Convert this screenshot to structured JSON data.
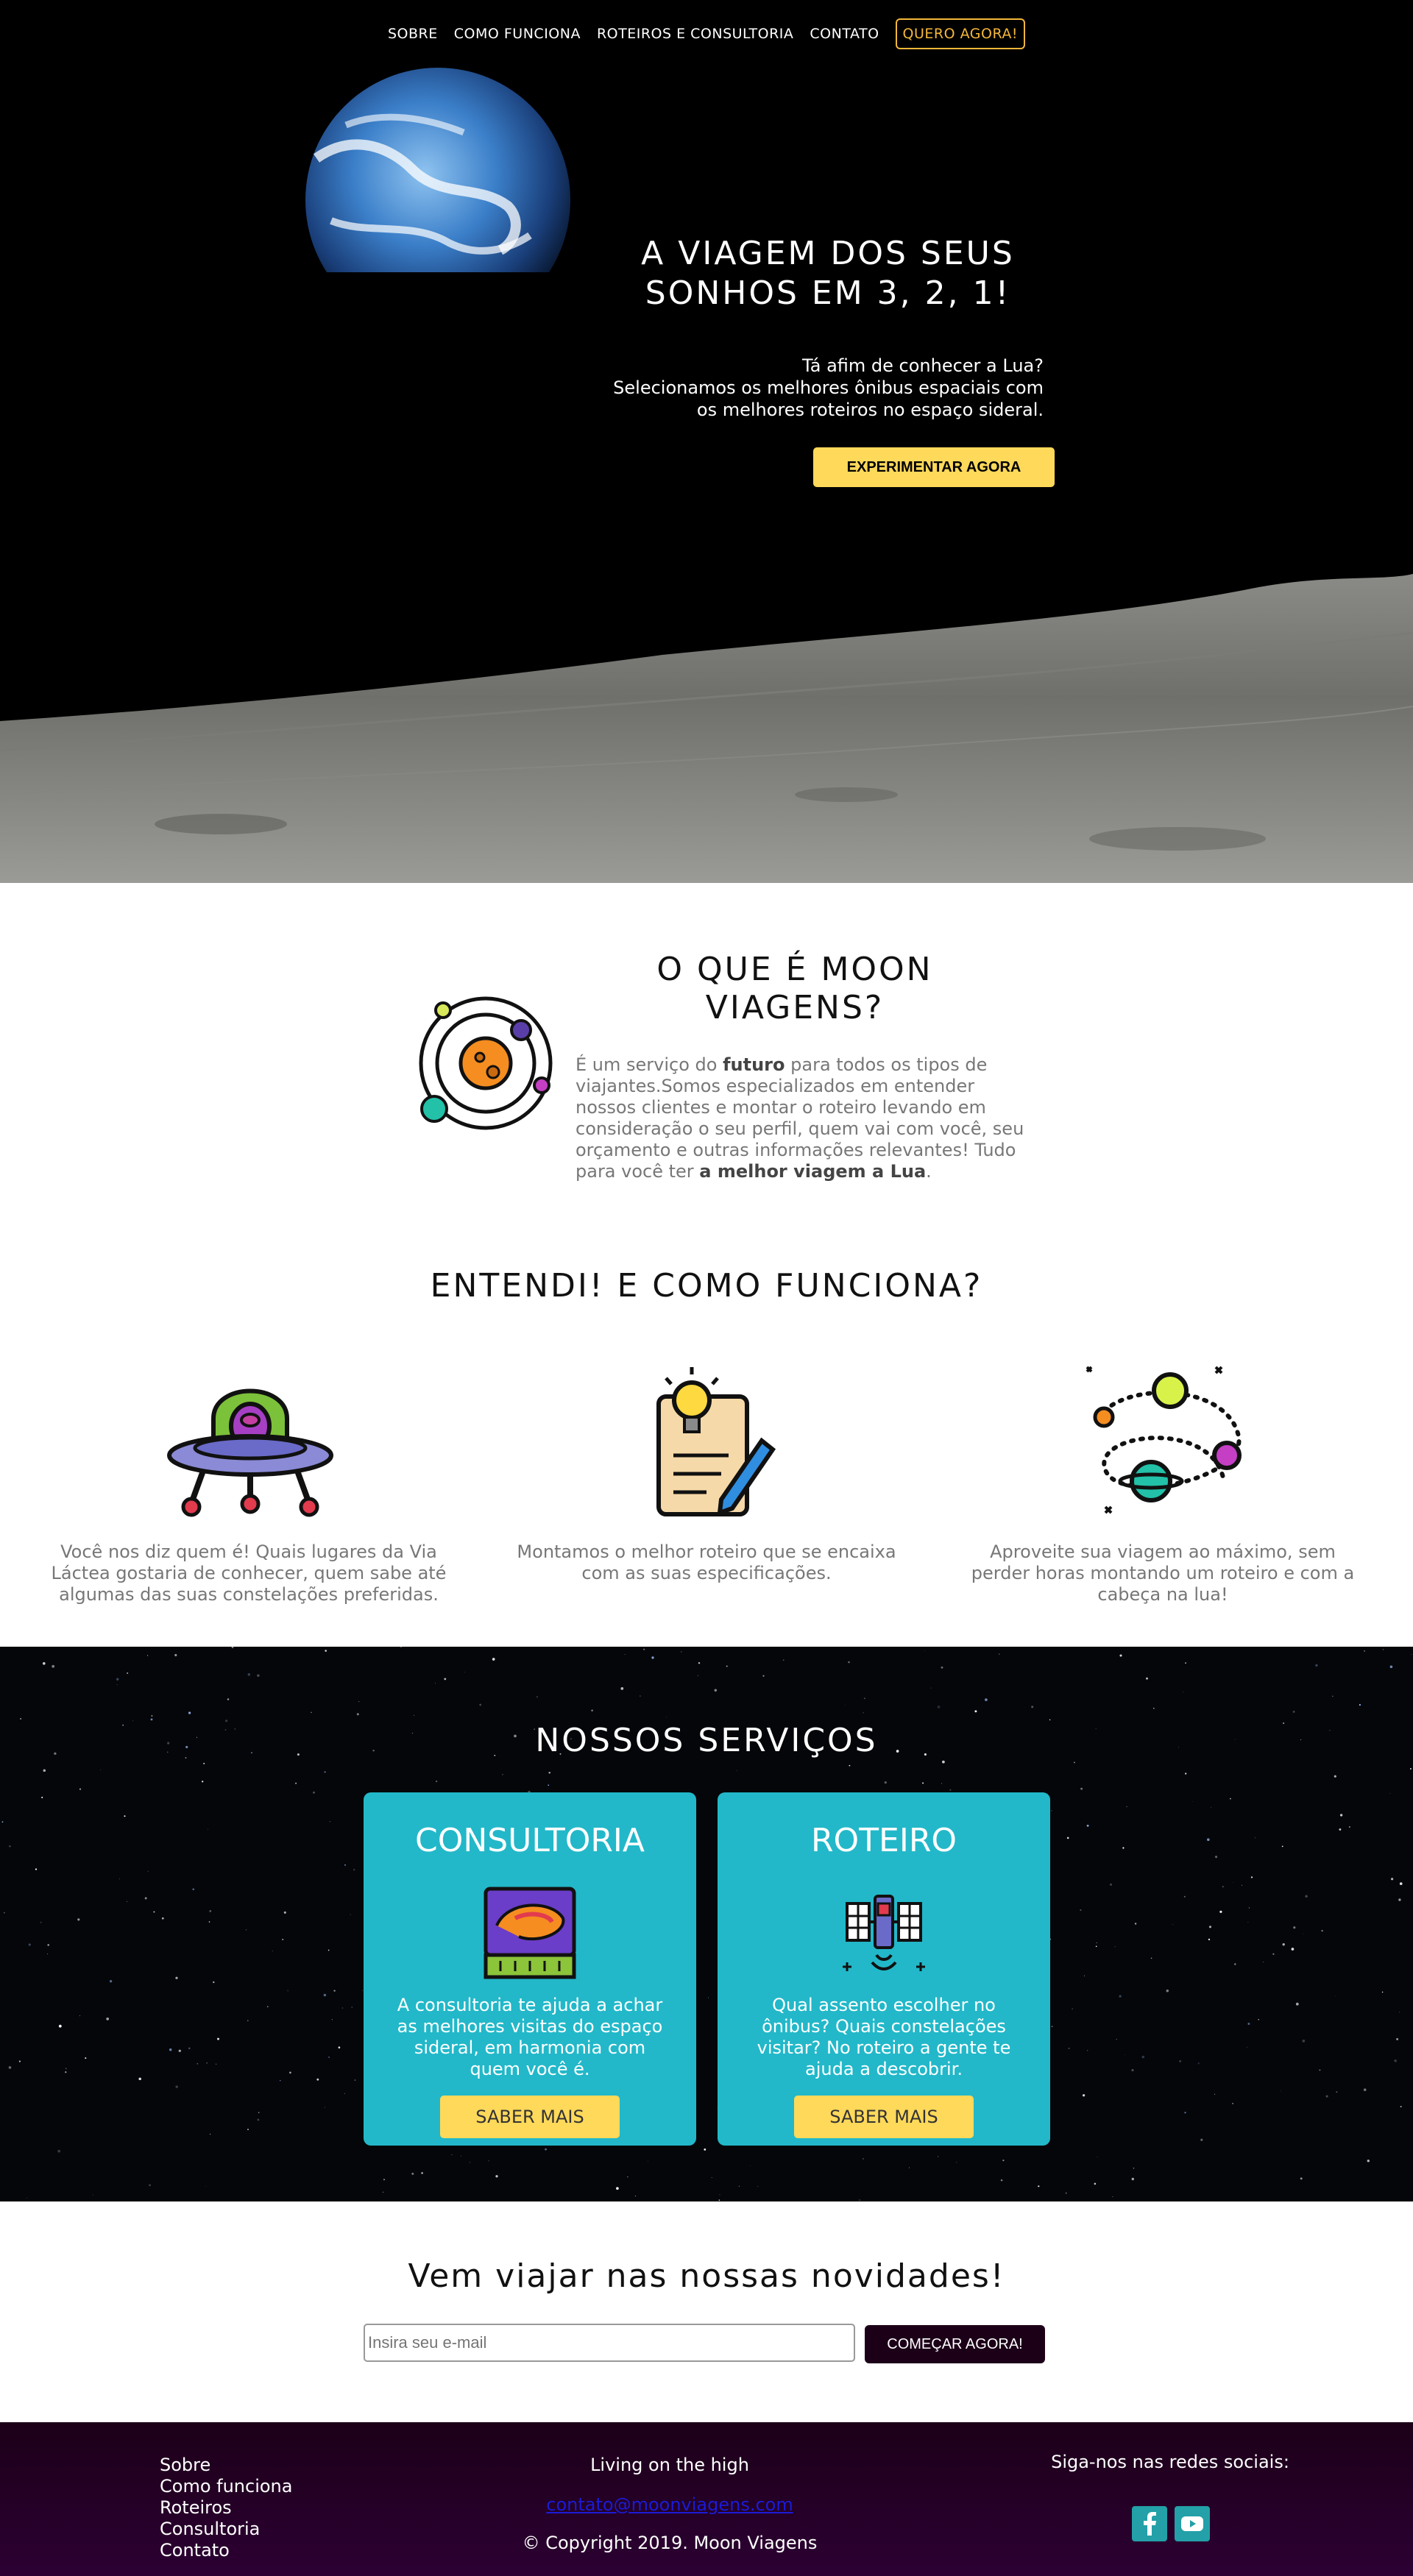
{
  "nav": {
    "items": [
      "SOBRE",
      "COMO FUNCIONA",
      "ROTEIROS E CONSULTORIA",
      "CONTATO"
    ],
    "cta": "QUERO AGORA!"
  },
  "hero": {
    "title": "A VIAGEM DOS SEUS SONHOS EM 3, 2, 1!",
    "subtitle_lines": [
      "Tá afim de conhecer a Lua?",
      "Selecionamos os melhores ônibus espaciais com",
      "os melhores roteiros no espaço sideral."
    ],
    "button": "EXPERIMENTAR AGORA"
  },
  "about": {
    "title": "O QUE É MOON VIAGENS?",
    "text_1": "É um serviço do ",
    "bold_1": "futuro",
    "text_2": " para todos os tipos de viajantes.Somos especializados em entender nossos clientes e montar o roteiro levando em consideração o seu perfil, quem vai com você, seu orçamento e outras informações relevantes! Tudo para você ter ",
    "bold_2": "a melhor viagem a Lua",
    "text_3": ".",
    "icon": "solar-system-icon"
  },
  "how": {
    "title": "ENTENDI! E COMO FUNCIONA?",
    "steps": [
      {
        "icon": "alien-ufo-icon",
        "text": "Você nos diz quem é! Quais lugares da Via Láctea gostaria de conhecer, quem sabe até algumas das suas constelações preferidas."
      },
      {
        "icon": "idea-notepad-icon",
        "text": "Montamos o melhor roteiro que se encaixa com as suas especificações."
      },
      {
        "icon": "planets-orbit-icon",
        "text": "Aproveite sua viagem ao máximo, sem perder horas montando um roteiro e com a cabeça na lua!"
      }
    ]
  },
  "services": {
    "title": "NOSSOS SERVIÇOS",
    "cards": [
      {
        "title": "CONSULTORIA",
        "icon": "galaxy-monitor-icon",
        "text": "A consultoria te ajuda a achar as melhores visitas do espaço sideral, em harmonia com quem você é.",
        "button": "SABER MAIS"
      },
      {
        "title": "ROTEIRO",
        "icon": "satellite-icon",
        "text": "Qual assento escolher no ônibus? Quais constelações visitar? No roteiro a gente te ajuda a descobrir.",
        "button": "SABER MAIS"
      }
    ]
  },
  "newsletter": {
    "title": "Vem viajar nas nossas novidades!",
    "placeholder": "Insira seu e-mail",
    "button": "COMEÇAR AGORA!"
  },
  "footer": {
    "links": [
      "Sobre",
      "Como funciona",
      "Roteiros",
      "Consultoria",
      "Contato"
    ],
    "slogan": "Living on the high",
    "email": "contato@moonviagens.com",
    "copyright": "© Copyright 2019. Moon Viagens",
    "social_title": "Siga-nos nas redes sociais:",
    "social": [
      "facebook-icon",
      "youtube-icon"
    ]
  },
  "colors": {
    "accent_yellow": "#ffd95a",
    "nav_cta": "#f4b73a",
    "card_teal": "#22b8c9",
    "footer_dark": "#1c0018"
  }
}
